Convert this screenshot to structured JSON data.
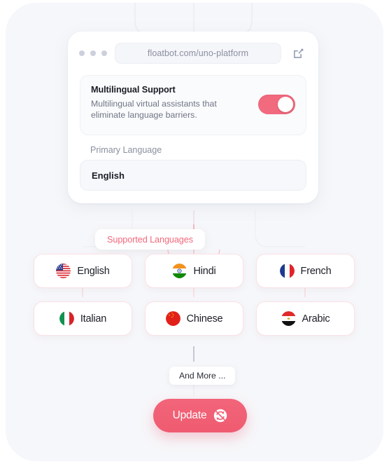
{
  "browser": {
    "url": "floatbot.com/uno-platform",
    "dots_count": 3,
    "external_icon": "external-link-icon"
  },
  "multilingual": {
    "title": "Multilingual Support",
    "description": "Multilingual virtual assistants that eliminate language barriers.",
    "toggle_state": "on",
    "toggle_color": "#F26A7E"
  },
  "primary_language": {
    "label": "Primary Language",
    "value": "English"
  },
  "supported": {
    "pill_label": "Supported Languages",
    "pill_color": "#F2687C",
    "languages": [
      {
        "name": "English",
        "flag": "flag-us-icon"
      },
      {
        "name": "Hindi",
        "flag": "flag-in-icon"
      },
      {
        "name": "French",
        "flag": "flag-fr-icon"
      },
      {
        "name": "Italian",
        "flag": "flag-it-icon"
      },
      {
        "name": "Chinese",
        "flag": "flag-cn-icon"
      },
      {
        "name": "Arabic",
        "flag": "flag-eg-icon"
      }
    ]
  },
  "and_more": {
    "label": "And More ..."
  },
  "update": {
    "label": "Update",
    "icon": "refresh-icon",
    "color": "#F2657A"
  }
}
